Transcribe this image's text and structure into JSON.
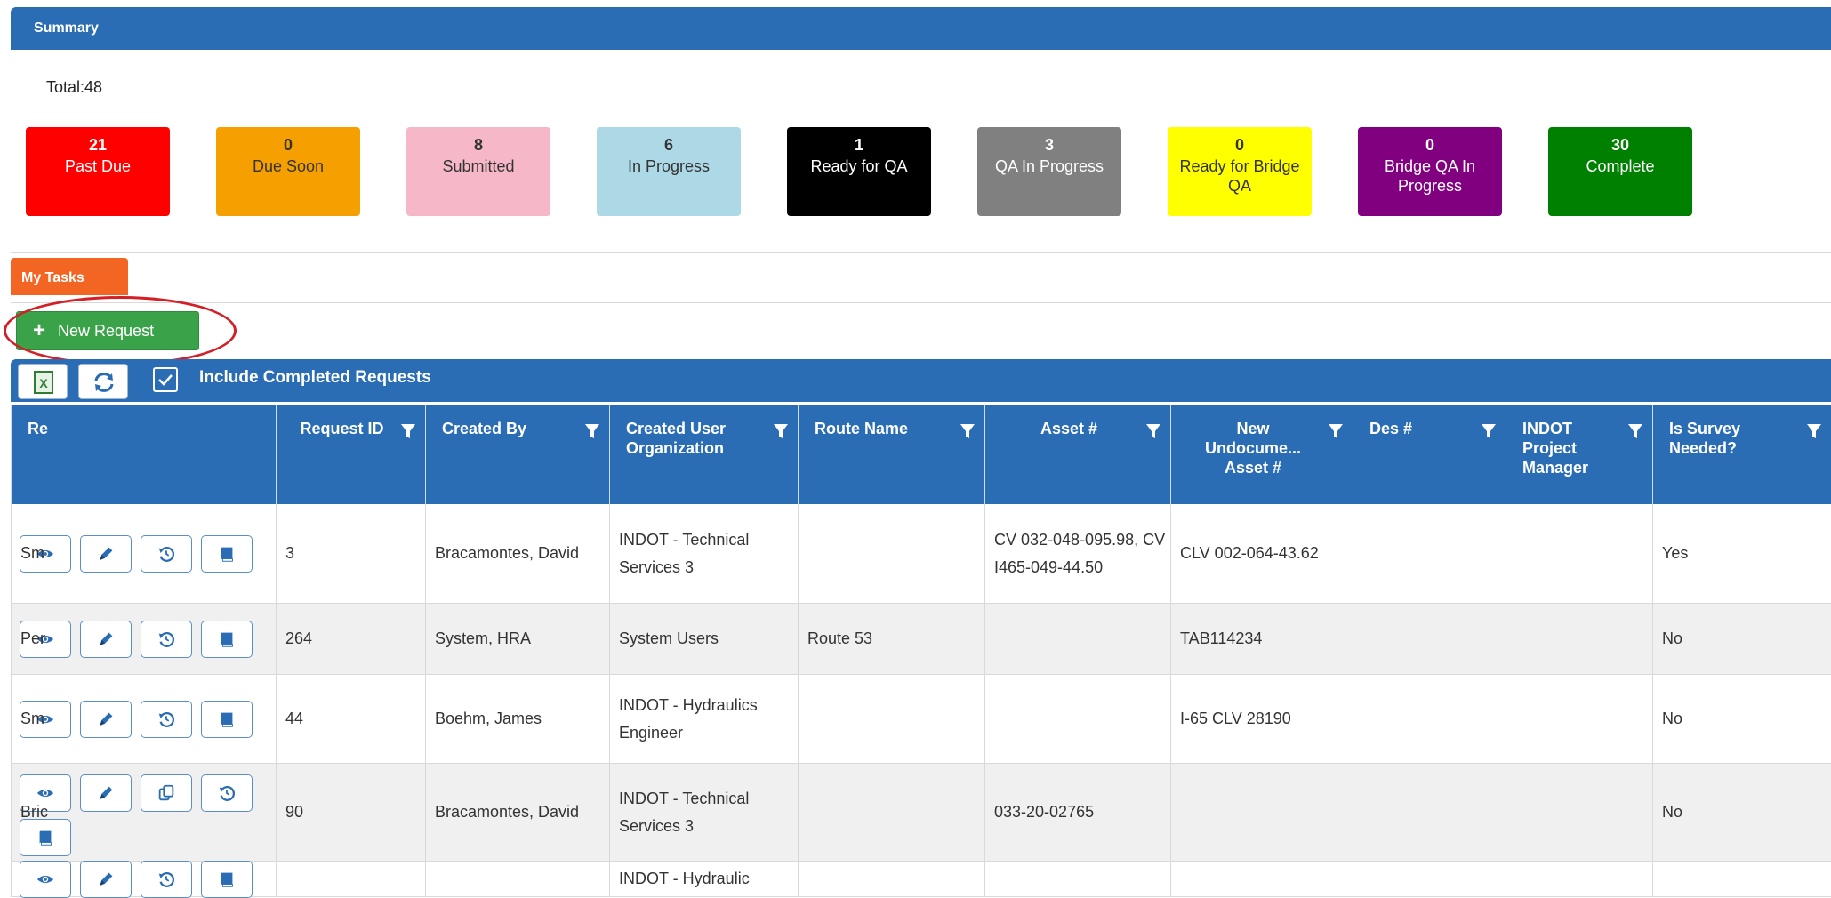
{
  "summary": {
    "title": "Summary",
    "total_label": "Total:48",
    "cards": [
      {
        "count": "21",
        "label": "Past Due",
        "bg": "#ff0000",
        "fg": "#ffffff"
      },
      {
        "count": "0",
        "label": "Due Soon",
        "bg": "#f5a000",
        "fg": "#333333"
      },
      {
        "count": "8",
        "label": "Submitted",
        "bg": "#f6b8c8",
        "fg": "#333333"
      },
      {
        "count": "6",
        "label": "In Progress",
        "bg": "#add8e6",
        "fg": "#333333"
      },
      {
        "count": "1",
        "label": "Ready for QA",
        "bg": "#000000",
        "fg": "#ffffff"
      },
      {
        "count": "3",
        "label": "QA In Progress",
        "bg": "#808080",
        "fg": "#ffffff"
      },
      {
        "count": "0",
        "label": "Ready for Bridge QA",
        "bg": "#ffff00",
        "fg": "#333333"
      },
      {
        "count": "0",
        "label": "Bridge QA In Progress",
        "bg": "#800080",
        "fg": "#ffffff"
      },
      {
        "count": "30",
        "label": "Complete",
        "bg": "#008000",
        "fg": "#ffffff"
      }
    ]
  },
  "tabs": {
    "my_tasks": "My Tasks"
  },
  "actions": {
    "new_request_label": "New Request"
  },
  "toolbar": {
    "include_completed_label": "Include Completed Requests",
    "include_completed_checked": true
  },
  "grid": {
    "columns": [
      {
        "label": "Request ID"
      },
      {
        "label": "Created By"
      },
      {
        "label": "Created User Organization"
      },
      {
        "label": "Route Name"
      },
      {
        "label": "Asset #"
      },
      {
        "label": "New Undocume... Asset #"
      },
      {
        "label": "Des #"
      },
      {
        "label": "INDOT Project Manager"
      },
      {
        "label": "Is Survey Needed?"
      },
      {
        "label": "Re"
      }
    ],
    "rows": [
      {
        "buttons": [
          "eye-icon",
          "pencil-icon",
          "history-icon",
          "book-icon"
        ],
        "request_id": "3",
        "created_by": "Bracamontes, David",
        "organization": "INDOT - Technical Services 3",
        "route_name": "",
        "asset": "CV 032-048-095.98, CV I465-049-44.50",
        "new_asset": "CLV 002-064-43.62",
        "des": "",
        "pm": "",
        "survey": "Yes",
        "re": "Sm"
      },
      {
        "buttons": [
          "eye-icon",
          "pencil-icon",
          "history-icon",
          "book-icon"
        ],
        "request_id": "264",
        "created_by": "System, HRA",
        "organization": "System Users",
        "route_name": "Route 53",
        "asset": "",
        "new_asset": "TAB114234",
        "des": "",
        "pm": "",
        "survey": "No",
        "re": "Per"
      },
      {
        "buttons": [
          "eye-icon",
          "pencil-icon",
          "history-icon",
          "book-icon"
        ],
        "request_id": "44",
        "created_by": "Boehm, James",
        "organization": "INDOT - Hydraulics Engineer",
        "route_name": "",
        "asset": "",
        "new_asset": "I-65 CLV 28190",
        "des": "",
        "pm": "",
        "survey": "No",
        "re": "Sm"
      },
      {
        "buttons": [
          "eye-icon",
          "pencil-icon",
          "copy-icon",
          "history-icon",
          "book-icon"
        ],
        "request_id": "90",
        "created_by": "Bracamontes, David",
        "organization": "INDOT - Technical Services 3",
        "route_name": "",
        "asset": "033-20-02765",
        "new_asset": "",
        "des": "",
        "pm": "",
        "survey": "No",
        "re": "Bric"
      },
      {
        "buttons": [
          "eye-icon",
          "pencil-icon",
          "history-icon",
          "book-icon"
        ],
        "request_id": "",
        "created_by": "",
        "organization": "INDOT - Hydraulic",
        "route_name": "",
        "asset": "",
        "new_asset": "",
        "des": "",
        "pm": "",
        "survey": "",
        "re": ""
      }
    ]
  },
  "colors": {
    "header_blue": "#2a6db5",
    "tab_orange": "#f26522",
    "button_green": "#3aa34a",
    "highlight_red": "#d32027",
    "alt_row": "#f0f0f0"
  }
}
